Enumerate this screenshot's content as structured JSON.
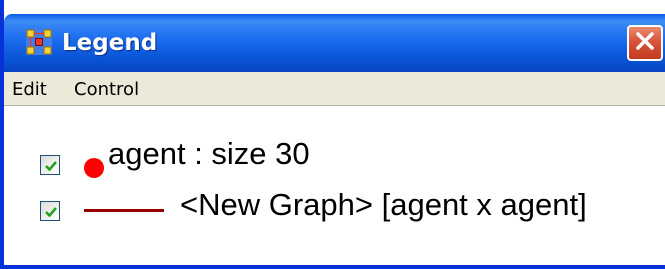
{
  "window": {
    "title": "Legend",
    "title_color": "#ffffff",
    "titlebar_color": "#0a55d8",
    "close_color": "#d8543a",
    "icons": {
      "app": "node-network-icon",
      "close": "close-icon"
    }
  },
  "menu": {
    "items": [
      {
        "label": "Edit"
      },
      {
        "label": "Control"
      }
    ]
  },
  "legend": {
    "items": [
      {
        "checked": true,
        "symbol": "red-dot-icon",
        "symbol_color": "#ff0000",
        "label": "agent : size 30"
      },
      {
        "checked": true,
        "symbol": "edge-line-icon",
        "symbol_color": "#990000",
        "label": "<New Graph> [agent x agent]"
      }
    ]
  }
}
